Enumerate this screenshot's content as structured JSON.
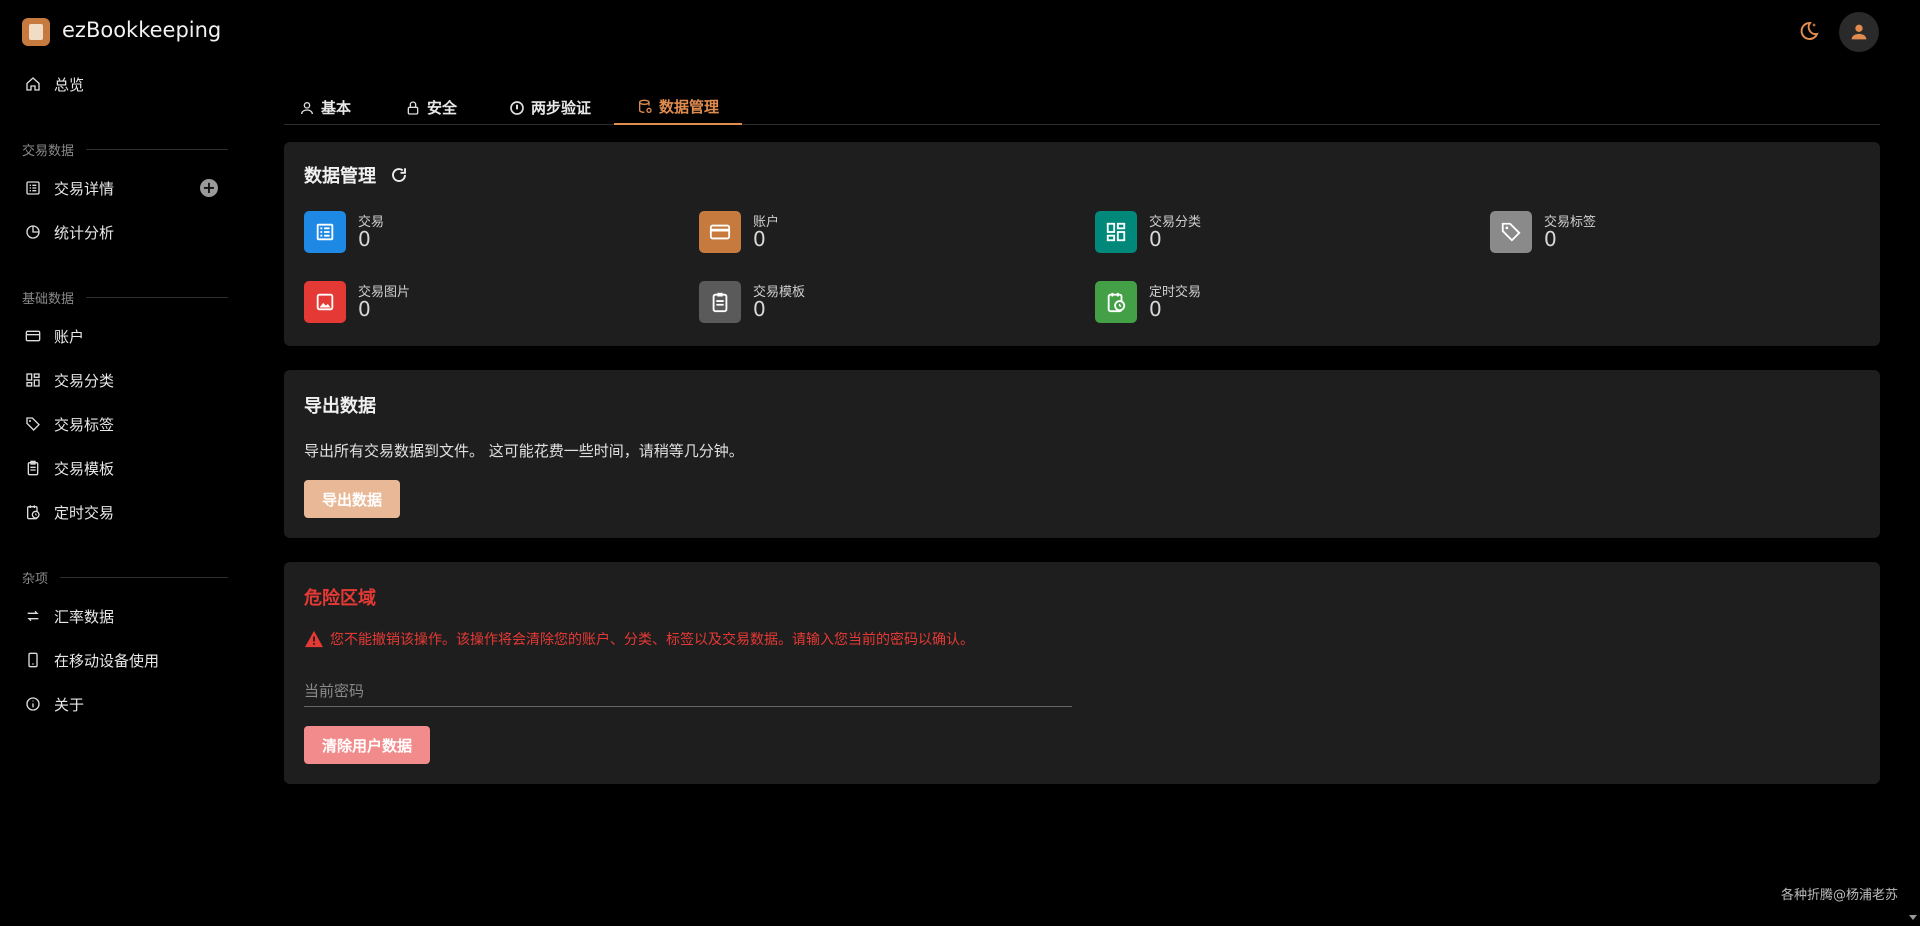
{
  "app": {
    "title": "ezBookkeeping"
  },
  "sidebar": {
    "overview": "总览",
    "sections": [
      {
        "title": "交易数据"
      },
      {
        "title": "基础数据"
      },
      {
        "title": "杂项"
      }
    ],
    "items": {
      "transaction_details": "交易详情",
      "statistics": "统计分析",
      "accounts": "账户",
      "categories": "交易分类",
      "tags": "交易标签",
      "templates": "交易模板",
      "scheduled": "定时交易",
      "exchange_rates": "汇率数据",
      "mobile": "在移动设备使用",
      "about": "关于"
    }
  },
  "tabs": [
    {
      "label": "基本",
      "icon": "user-icon"
    },
    {
      "label": "安全",
      "icon": "lock-icon"
    },
    {
      "label": "两步验证",
      "icon": "two-factor-icon"
    },
    {
      "label": "数据管理",
      "icon": "database-settings-icon",
      "active": true
    }
  ],
  "data_management": {
    "title": "数据管理",
    "stats": [
      {
        "label": "交易",
        "value": "0",
        "color": "#1e88e5",
        "icon": "list-icon"
      },
      {
        "label": "账户",
        "value": "0",
        "color": "#c67a3e",
        "icon": "credit-card-icon"
      },
      {
        "label": "交易分类",
        "value": "0",
        "color": "#00897b",
        "icon": "grid-icon"
      },
      {
        "label": "交易标签",
        "value": "0",
        "color": "#8a8a8a",
        "icon": "tag-icon"
      },
      {
        "label": "交易图片",
        "value": "0",
        "color": "#e53935",
        "icon": "image-icon"
      },
      {
        "label": "交易模板",
        "value": "0",
        "color": "#5a5a5a",
        "icon": "clipboard-icon"
      },
      {
        "label": "定时交易",
        "value": "0",
        "color": "#43a047",
        "icon": "calendar-clock-icon"
      }
    ]
  },
  "export": {
    "title": "导出数据",
    "description": "导出所有交易数据到文件。 这可能花费一些时间，请稍等几分钟。",
    "button": "导出数据",
    "button_color": "#e9b896"
  },
  "danger": {
    "title": "危险区域",
    "warning": "您不能撤销该操作。该操作将会清除您的账户、分类、标签以及交易数据。请输入您当前的密码以确认。",
    "password_placeholder": "当前密码",
    "button": "清除用户数据",
    "accent": "#e53935",
    "button_color": "#f28b8b"
  },
  "footer": {
    "note": "各种折腾@杨浦老苏"
  }
}
